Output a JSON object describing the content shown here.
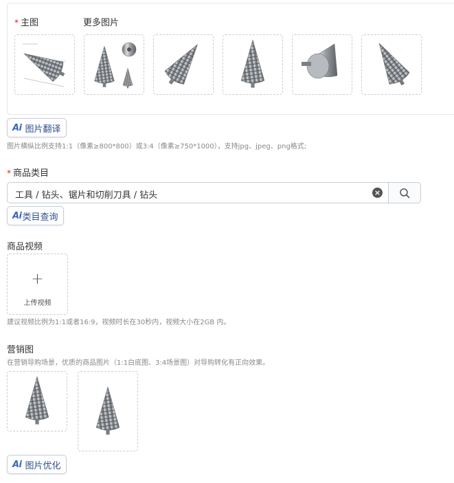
{
  "main_image": {
    "required_mark": "*",
    "label": "主图",
    "more_label": "更多图片",
    "thumbnails": [
      {
        "icon": "step-drill-diagram-icon"
      },
      {
        "icon": "step-drill-set-icon"
      },
      {
        "icon": "step-drill-angled-icon"
      },
      {
        "icon": "step-drill-upright-icon"
      },
      {
        "icon": "step-drill-end-view-icon"
      },
      {
        "icon": "step-drill-tilted-icon"
      }
    ]
  },
  "image_translate": {
    "ai": "Ai",
    "label": "图片翻译"
  },
  "image_hint": "图片横纵比例支持1:1（像素≥800*800）或3:4（像素≥750*1000），支持jpg、jpeg、png格式;",
  "category": {
    "required_mark": "*",
    "label": "商品类目",
    "value": "工具 / 钻头、锯片和切削刀具 / 钻头",
    "clear_icon": "clear-circle-icon",
    "search_icon": "search-icon"
  },
  "category_query": {
    "ai": "Ai",
    "label": "类目查询"
  },
  "video": {
    "label": "商品视频",
    "upload_plus": "+",
    "upload_label": "上传视频",
    "hint": "建议视频比例为1:1或者16:9，视频时长在30秒内，视频大小在2GB 内。"
  },
  "marketing": {
    "label": "营销图",
    "hint": "在营销导购场景，优质的商品图片（1:1白底图、3:4场景图）对导购转化有正向效果。",
    "thumbnails": [
      {
        "icon": "step-drill-square-icon"
      },
      {
        "icon": "step-drill-portrait-icon"
      }
    ]
  },
  "image_optimize": {
    "ai": "Ai",
    "label": "图片优化"
  },
  "colors": {
    "accent": "#3a66c4",
    "required": "#e02020",
    "border": "#c8ccd4"
  }
}
